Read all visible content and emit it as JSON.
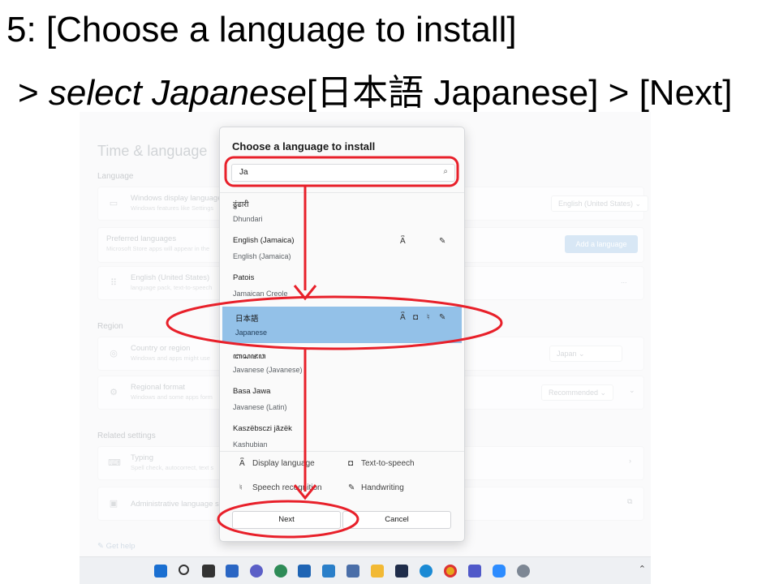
{
  "slide": {
    "title_line1": "5: [Choose a language to install]",
    "title_line2_a": "> ",
    "title_line2_italic": "select Japanese",
    "title_line2_b": "[日本語 Japanese] > [Next]"
  },
  "settings": {
    "page_title": "Time & language",
    "section_language": "Language",
    "display_language": {
      "title": "Windows display language",
      "desc": "Windows features like Settings",
      "value": "English (United States)"
    },
    "preferred": {
      "title": "Preferred languages",
      "desc": "Microsoft Store apps will appear in the",
      "add_button": "Add a language"
    },
    "english_us": {
      "title": "English (United States)",
      "desc": "language pack, text-to-speech",
      "more": "..."
    },
    "section_region": "Region",
    "country": {
      "title": "Country or region",
      "desc": "Windows and apps might use",
      "value": "Japan"
    },
    "regional_format": {
      "title": "Regional format",
      "desc": "Windows and some apps form",
      "value": "Recommended"
    },
    "section_related": "Related settings",
    "typing": {
      "title": "Typing",
      "desc": "Spell check, autocorrect, text s"
    },
    "admin": {
      "title": "Administrative language s"
    },
    "get_help": "Get help"
  },
  "dialog": {
    "title": "Choose a language to install",
    "search_value": "Ja",
    "languages": [
      {
        "name": "ढुंढारी",
        "sub": "Dhundari",
        "features": []
      },
      {
        "name": "English (Jamaica)",
        "sub": "English (Jamaica)",
        "features": [
          "display-language-icon",
          "handwriting-icon"
        ]
      },
      {
        "name": "Patois",
        "sub": "Jamaican Creole",
        "features": []
      },
      {
        "name": "日本語",
        "sub": "Japanese",
        "features": [
          "display-language-icon",
          "text-to-speech-icon",
          "speech-recognition-icon",
          "handwriting-icon"
        ],
        "selected": true
      },
      {
        "name": "ꦧꦱꦗꦮ",
        "sub": "Javanese (Javanese)",
        "features": []
      },
      {
        "name": "Basa Jawa",
        "sub": "Javanese (Latin)",
        "features": []
      },
      {
        "name": "Kaszëbsczi jãzëk",
        "sub": "Kashubian",
        "features": []
      }
    ],
    "legend": {
      "display_language": "Display language",
      "text_to_speech": "Text-to-speech",
      "speech_recognition": "Speech recognition",
      "handwriting": "Handwriting"
    },
    "next_button": "Next",
    "cancel_button": "Cancel"
  },
  "annotation_color": "#e8202a",
  "taskbar_icons": [
    "windows-start-icon",
    "search-icon",
    "task-view-icon",
    "widgets-icon",
    "chat-icon",
    "browser-icon",
    "mail-icon",
    "monitor-icon",
    "remote-icon",
    "file-explorer-icon",
    "security-icon",
    "edge-icon",
    "chrome-icon",
    "teams-icon",
    "zoom-icon",
    "settings-icon"
  ]
}
